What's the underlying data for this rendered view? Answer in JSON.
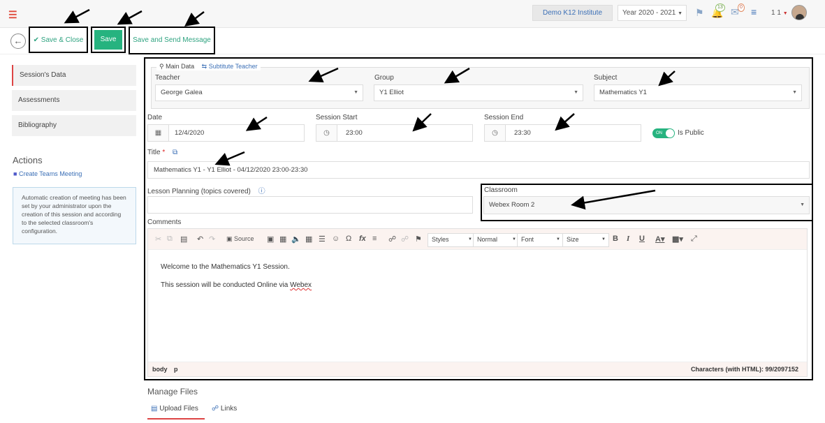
{
  "header": {
    "institute": "Demo K12 Institute",
    "year": "Year 2020 - 2021",
    "notifications_count": "13",
    "messages_count": "0",
    "user_initials": "1 1"
  },
  "toolbar": {
    "save_close_label": "Save & Close",
    "save_label": "Save",
    "save_send_label": "Save and Send Message"
  },
  "sidebar": {
    "items": [
      {
        "label": "Session's Data"
      },
      {
        "label": "Assessments"
      },
      {
        "label": "Bibliography"
      }
    ],
    "actions_heading": "Actions",
    "teams_link": "Create Teams Meeting",
    "info_text": "Automatic creation of meeting has been set by your administrator upon the creation of this session and according to the selected classroom's configuration."
  },
  "tabs": {
    "main_data": "Main Data",
    "substitute": "Subtitute Teacher"
  },
  "form": {
    "teacher_label": "Teacher",
    "teacher_value": "George Galea",
    "group_label": "Group",
    "group_value": "Y1 Elliot",
    "subject_label": "Subject",
    "subject_value": "Mathematics Y1",
    "date_label": "Date",
    "date_value": "12/4/2020",
    "start_label": "Session Start",
    "start_value": "23:00",
    "end_label": "Session End",
    "end_value": "23:30",
    "toggle_text": "ON",
    "public_label": "Is Public",
    "title_label": "Title",
    "required_mark": "*",
    "title_value": "Mathematics Y1 - Y1 Elliot - 04/12/2020 23:00-23:30",
    "lesson_label": "Lesson Planning (topics covered)",
    "lesson_value": "",
    "classroom_label": "Classroom",
    "classroom_value": "Webex Room 2",
    "comments_label": "Comments"
  },
  "editor": {
    "source_label": "Source",
    "styles": "Styles",
    "format": "Normal",
    "font": "Font",
    "size": "Size",
    "line1": "Welcome to the Mathematics Y1 Session.",
    "line2_prefix": "This session will be conducted Online via ",
    "line2_link": "Webex",
    "path_body": "body",
    "path_p": "p",
    "char_count": "Characters (with HTML): 99/2097152"
  },
  "files": {
    "heading": "Manage Files",
    "upload_tab": "Upload Files",
    "links_tab": "Links"
  },
  "colors": {
    "accent": "#26b37f",
    "link": "#3b6fb6",
    "active_marker": "#dd4444"
  }
}
